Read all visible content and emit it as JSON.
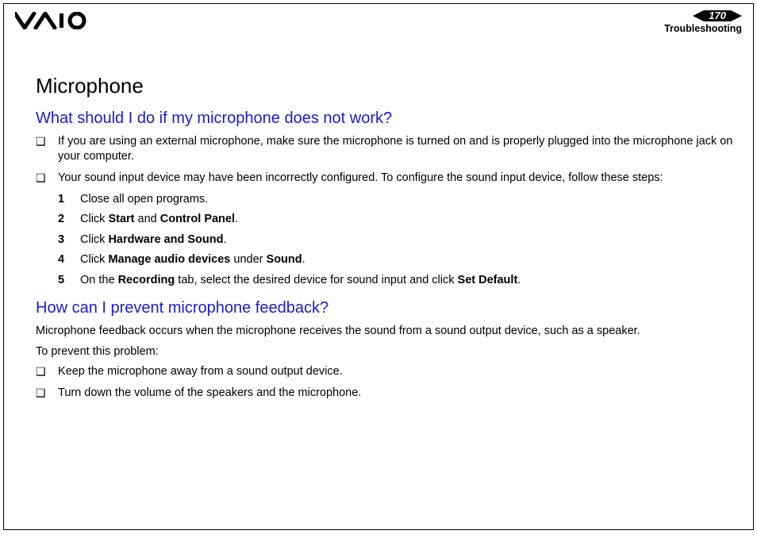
{
  "header": {
    "page_number": "170",
    "section": "Troubleshooting"
  },
  "title": "Microphone",
  "q1": {
    "heading": "What should I do if my microphone does not work?",
    "bullets": [
      "If you are using an external microphone, make sure the microphone is turned on and is properly plugged into the microphone jack on your computer.",
      "Your sound input device may have been incorrectly configured. To configure the sound input device, follow these steps:"
    ],
    "steps": [
      {
        "n": "1",
        "pre": "Close all open programs."
      },
      {
        "n": "2",
        "pre": "Click ",
        "b1": "Start",
        "mid": " and ",
        "b2": "Control Panel",
        "post": "."
      },
      {
        "n": "3",
        "pre": "Click ",
        "b1": "Hardware and Sound",
        "post": "."
      },
      {
        "n": "4",
        "pre": "Click ",
        "b1": "Manage audio devices",
        "mid": " under ",
        "b2": "Sound",
        "post": "."
      },
      {
        "n": "5",
        "pre": "On the ",
        "b1": "Recording",
        "mid": " tab, select the desired device for sound input and click ",
        "b2": "Set Default",
        "post": "."
      }
    ]
  },
  "q2": {
    "heading": "How can I prevent microphone feedback?",
    "intro": "Microphone feedback occurs when the microphone receives the sound from a sound output device, such as a speaker.",
    "lead": "To prevent this problem:",
    "bullets": [
      "Keep the microphone away from a sound output device.",
      "Turn down the volume of the speakers and the microphone."
    ]
  }
}
